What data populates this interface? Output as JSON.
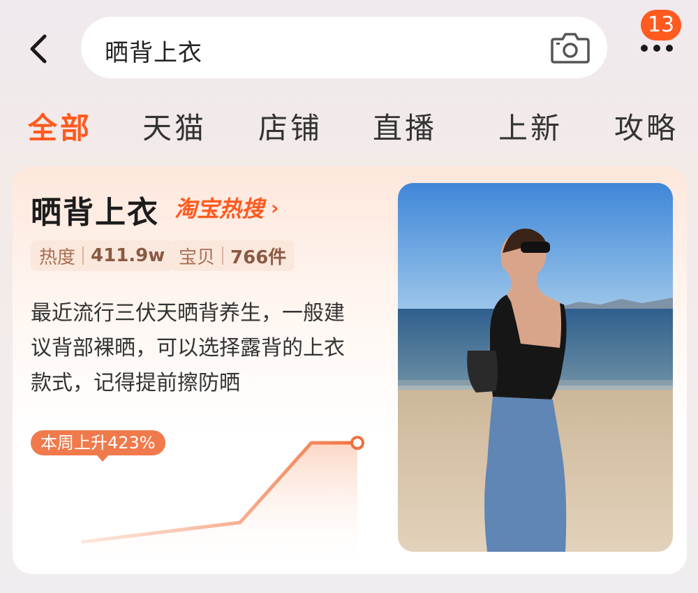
{
  "header": {
    "back_icon": "chevron-left-icon",
    "search_query": "晒背上衣",
    "camera_icon": "camera-icon",
    "more_icon": "more-dots-icon",
    "badge_count": "13"
  },
  "tabs": [
    {
      "label": "全部",
      "active": true
    },
    {
      "label": "天猫",
      "active": false
    },
    {
      "label": "店铺",
      "active": false
    },
    {
      "label": "直播",
      "active": false
    },
    {
      "label": "上新",
      "active": false
    },
    {
      "label": "攻略",
      "active": false
    }
  ],
  "card": {
    "title": "晒背上衣",
    "hot_link": "淘宝热搜",
    "stats": [
      {
        "label": "热度",
        "value": "411.9w"
      },
      {
        "label": "宝贝",
        "value": "766件"
      }
    ],
    "description": "最近流行三伏天晒背养生，一般建议背部裸晒，可以选择露背的上衣款式，记得提前擦防晒",
    "trend_label": "本周上升423%",
    "photo_icon": "woman-beach-photo",
    "accent_color": "#ff5a1f"
  }
}
